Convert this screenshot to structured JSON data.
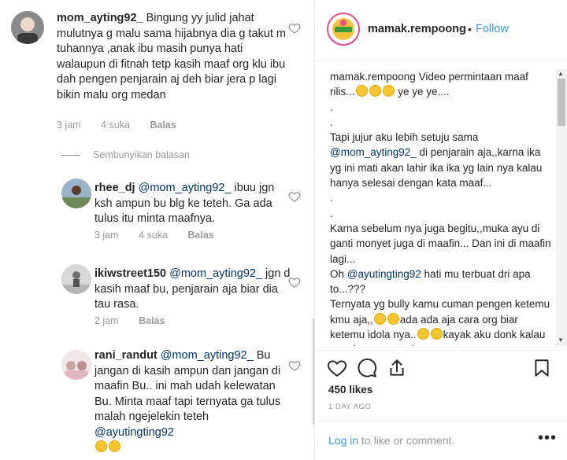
{
  "comments": [
    {
      "username": "mom_ayting92_",
      "text": " Bingung yy julid jahat mulutnya g malu sama hijabnya dia g takut m tuhannya ,anak ibu masih punya hati walaupun di fitnah tetp kasih maaf org klu ibu dah pengen penjarain aj deh biar jera p lagi bikin malu org medan",
      "time": "3 jam",
      "likes": "4 suka",
      "reply": "Balas"
    }
  ],
  "hide_replies": "Sembunyikan balasan",
  "replies": [
    {
      "username": "rhee_dj",
      "mention": "@mom_ayting92_",
      "text": " ibuu jgn ksh ampun bu blg ke teteh. Gaya di tulus itu minta maafnya.",
      "time": "3 jam",
      "likes": "4 suka",
      "reply": "Balas"
    },
    {
      "username": "ikiwstreet150",
      "mention": "@mom_ayting92_",
      "text": " jgn d kasih maaf bu,  penjarain aja biar dia tau rasa.",
      "time": "2 jam",
      "reply": "Balas"
    },
    {
      "username": "rani_randut",
      "mention": "@mom_ayting92_",
      "text": " Bu jangan di kasih ampun dan jangan di maafin Bu.. ini mah udah kelewatan Bu. Minta maaf tapi ternyata ga tulus malah ngejelekin teteh ",
      "mention2": "@ayutingting92"
    }
  ],
  "post": {
    "username": "mamak.rempoong",
    "dot": "•",
    "follow": "Follow",
    "caption_user": "mamak.rempoong",
    "caption_l1": " Video permintaan maaf rilis...",
    "caption_l1b": " ye ye ye....",
    "dot1": ".",
    "dot2": ".",
    "cap_2": "Tapi jujur aku lebih setuju sama ",
    "cap_2_mention": "@mom_ayting92_",
    "cap_2b": " di penjarain aja,,karna ika yg ini mati akan lahir ika ika yg lain nya kalau hanya selesai dengan kata maaf...",
    "dot3": ".",
    "dot4": ".",
    "cap_3": "Karna sebelum nya juga begitu,,muka ayu di ganti monyet juga di maafin... Dan ini di maafin lagi...",
    "cap_4a": "Oh ",
    "cap_4_mention": "@ayutingting92",
    "cap_4b": " hati mu terbuat dri apa to...???",
    "cap_5a": "Ternyata yg bully kamu cuman pengen ketemu kmu aja,,",
    "cap_5b": "ada ada aja cara org biar ketemu idola nya..",
    "cap_5c": "kayak aku donk kalau mau ketemu ayu ke",
    "likes": "450 likes",
    "date": "1 DAY AGO",
    "login_link": "Log in",
    "login_rest": " to like or comment.",
    "more": "•••"
  },
  "colors": {
    "link": "#3897f0",
    "mention": "#003569",
    "muted": "#999999"
  },
  "icons": [
    "heart-icon",
    "comment-icon",
    "share-icon",
    "bookmark-icon"
  ]
}
